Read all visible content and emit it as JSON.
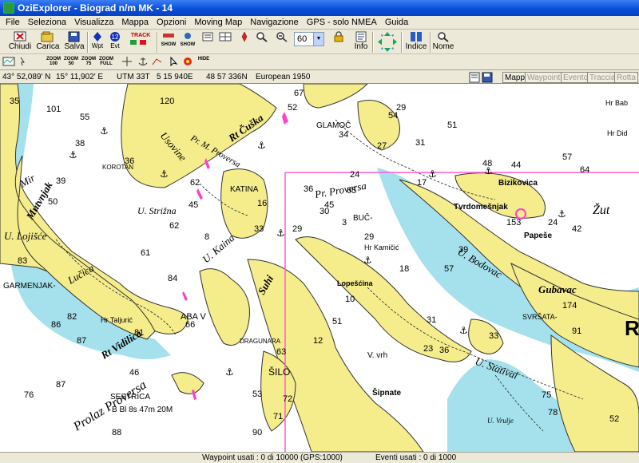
{
  "window": {
    "title": "OziExplorer - Biograd n/m  MK - 14"
  },
  "menu": [
    "File",
    "Seleziona",
    "Visualizza",
    "Mappa",
    "Opzioni",
    "Moving Map",
    "Navigazione",
    "GPS - solo NMEA",
    "Guida"
  ],
  "toolbar": {
    "chiudi": "Chiudi",
    "carica": "Carica",
    "salva": "Salva",
    "wpt": "Wpt",
    "evt": "Evt",
    "track": "TRACK",
    "show": "SHOW",
    "show2": "SHOW",
    "zoom_value": "60",
    "info": "Info",
    "indice": "Indice",
    "nome": "Nome",
    "zoom_labels": [
      "ZOOM 100",
      "ZOOM 50",
      "ZOOM 75",
      "ZOOM FULL"
    ],
    "hide": "HIDE"
  },
  "coords": {
    "lat": "43° 52,089' N",
    "lon": "15° 11,902' E",
    "utm": "UTM 33T",
    "easting": "5 15 940E",
    "northing": "48 57 336N",
    "datum": "European 1950"
  },
  "map_tabs": [
    "Mappa",
    "Waypoint",
    "Evento",
    "Traccia",
    "Rotta"
  ],
  "status": {
    "waypoints": "Waypoint usati : 0 di 10000  (GPS:1000)",
    "events": "Eventi usati : 0 di 1000"
  },
  "colors": {
    "land": "#f5ec8c",
    "shallow": "#a4e1ec",
    "sea": "#ffffff",
    "route": "#ff5bd6",
    "marker": "#ff3fce"
  },
  "map": {
    "places": [
      "GLAMOČ",
      "KOROTAN",
      "Usovine",
      "Rt Čuška",
      "KATINA",
      "GARMENJAK-",
      "Lučica",
      "SESTRICA",
      "B Bl 8s 47m 20M",
      "Prolaz Proversa",
      "Rt Vidilica",
      "ABA V",
      "ŠILO",
      "V. vrh",
      "Šipnate",
      "Bizikovica",
      "Tvrdomešnjak",
      "Papeše",
      "Gubavac",
      "Hr Kamičić",
      "Lopešćina",
      "BUČ-",
      "SVRŠATA-",
      "Hr Taljurić",
      "U. Lojišće",
      "U. Statival",
      "Mir",
      "Mutvnjak",
      "U. Kaina",
      "Pr. Proversa",
      "U. Bodovac",
      "Pr. M. Proversa",
      "Žut",
      "DRAGUNARA",
      "U. Strižna",
      "Suhi",
      "U. Vrulje",
      "Hr Bab",
      "Hr Did",
      "Rt Žut"
    ],
    "soundings": [
      "35",
      "120",
      "101",
      "52",
      "55",
      "67",
      "29",
      "54",
      "34",
      "51",
      "38",
      "31",
      "27",
      "36",
      "17",
      "39",
      "24",
      "65",
      "45",
      "36",
      "50",
      "45",
      "62",
      "8",
      "16",
      "44",
      "57",
      "48",
      "30",
      "29",
      "64",
      "42",
      "39",
      "62",
      "61",
      "83",
      "82",
      "57",
      "29",
      "33",
      "24",
      "51",
      "86",
      "87",
      "87",
      "76",
      "66",
      "81",
      "84",
      "46",
      "88",
      "90",
      "53",
      "72",
      "71",
      "63",
      "12",
      "18",
      "31",
      "33",
      "23",
      "36",
      "91",
      "75",
      "78",
      "52",
      "10",
      "3",
      "174",
      "153"
    ]
  }
}
